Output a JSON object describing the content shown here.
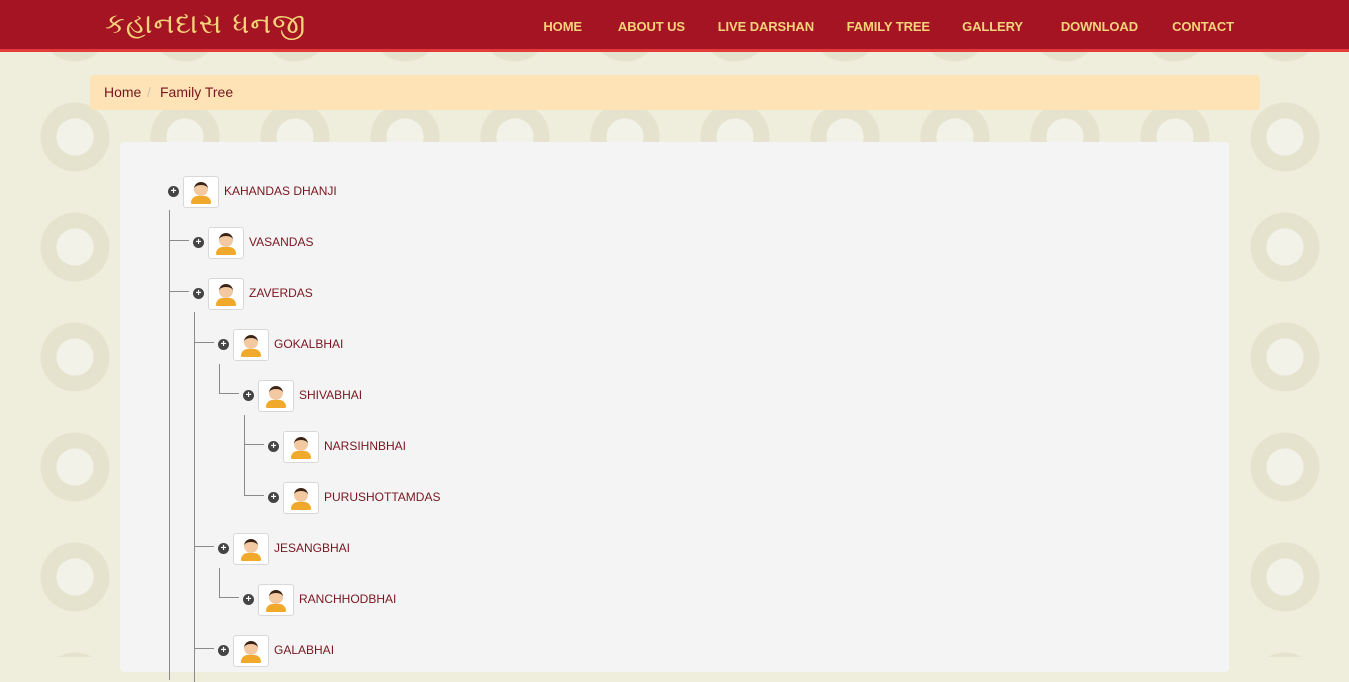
{
  "header": {
    "logo": "કહાનદાસ ધનજી",
    "nav": [
      {
        "label": "HOME"
      },
      {
        "label": "ABOUT US"
      },
      {
        "label": "LIVE DARSHAN"
      },
      {
        "label": "FAMILY TREE"
      },
      {
        "label": "GALLERY"
      },
      {
        "label": "DOWNLOAD"
      },
      {
        "label": "CONTACT"
      }
    ]
  },
  "breadcrumb": {
    "home": "Home",
    "separator": "/",
    "current": "Family Tree"
  },
  "tree": {
    "nodes": [
      {
        "name": "KAHANDAS DHANJI",
        "toggle": "+"
      },
      {
        "name": "VASANDAS",
        "toggle": "+"
      },
      {
        "name": "ZAVERDAS",
        "toggle": "+"
      },
      {
        "name": "GOKALBHAI",
        "toggle": "+"
      },
      {
        "name": "SHIVABHAI",
        "toggle": "+"
      },
      {
        "name": "NARSIHNBHAI",
        "toggle": "+"
      },
      {
        "name": "PURUSHOTTAMDAS",
        "toggle": "+"
      },
      {
        "name": "JESANGBHAI",
        "toggle": "+"
      },
      {
        "name": "RANCHHODBHAI",
        "toggle": "+"
      },
      {
        "name": "GALABHAI",
        "toggle": "+"
      }
    ]
  },
  "colors": {
    "header_bg": "#a51422",
    "header_accent": "#e53a3a",
    "nav_text": "#f5d37b",
    "breadcrumb_bg": "#fde3b5",
    "node_text": "#7a1520",
    "page_bg": "#efeedd",
    "panel_bg": "#f4f4f4"
  },
  "icons": {
    "toggle": "plus-circle-icon",
    "avatar": "person-avatar-icon"
  }
}
